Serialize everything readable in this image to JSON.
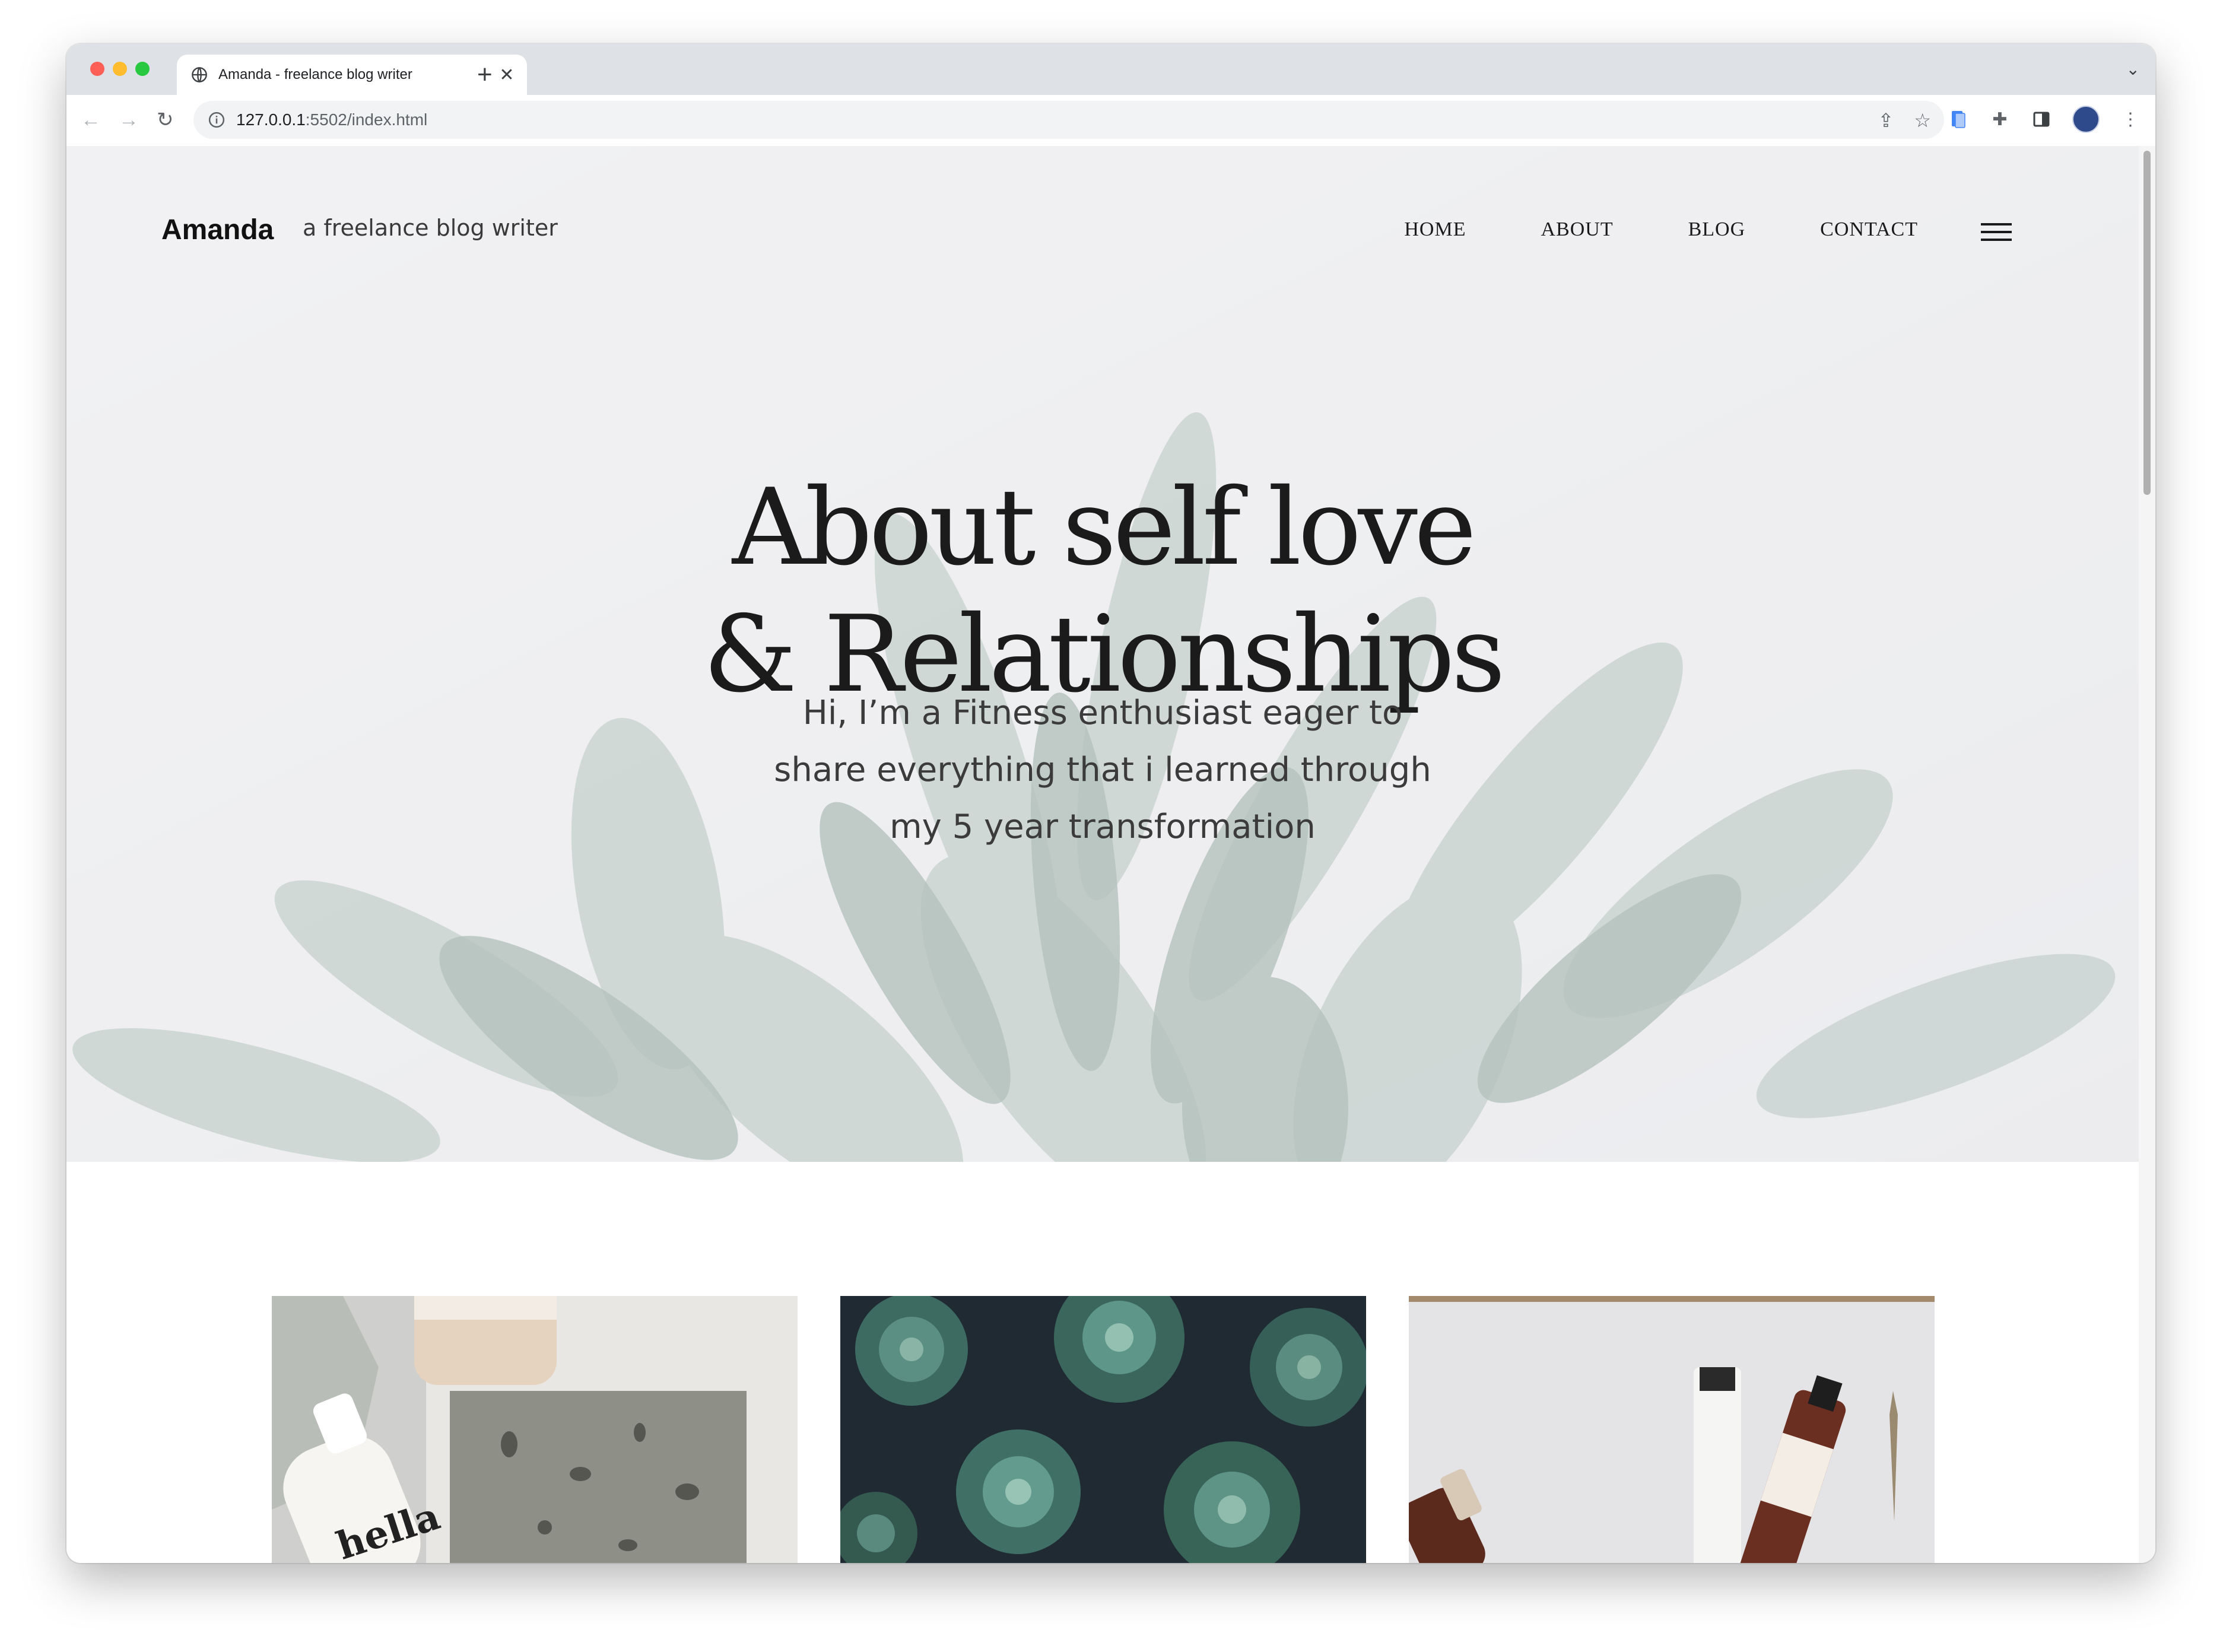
{
  "browser": {
    "tab_title": "Amanda - freelance blog writer",
    "tab_close": "✕",
    "new_tab": "+",
    "url_host": "127.0.0.1",
    "url_path": ":5502/index.html"
  },
  "site": {
    "brand": "Amanda",
    "tagline": "a freelance blog writer",
    "nav": [
      "HOME",
      "ABOUT",
      "BLOG",
      "CONTACT"
    ]
  },
  "hero": {
    "title_line1": "About self love",
    "title_line2": "& Relationships",
    "subtitle": "Hi, I’m a Fitness enthusiast eager to share everything that i learned through my 5 year transformation"
  },
  "cards": {
    "card1_label": "hella"
  }
}
